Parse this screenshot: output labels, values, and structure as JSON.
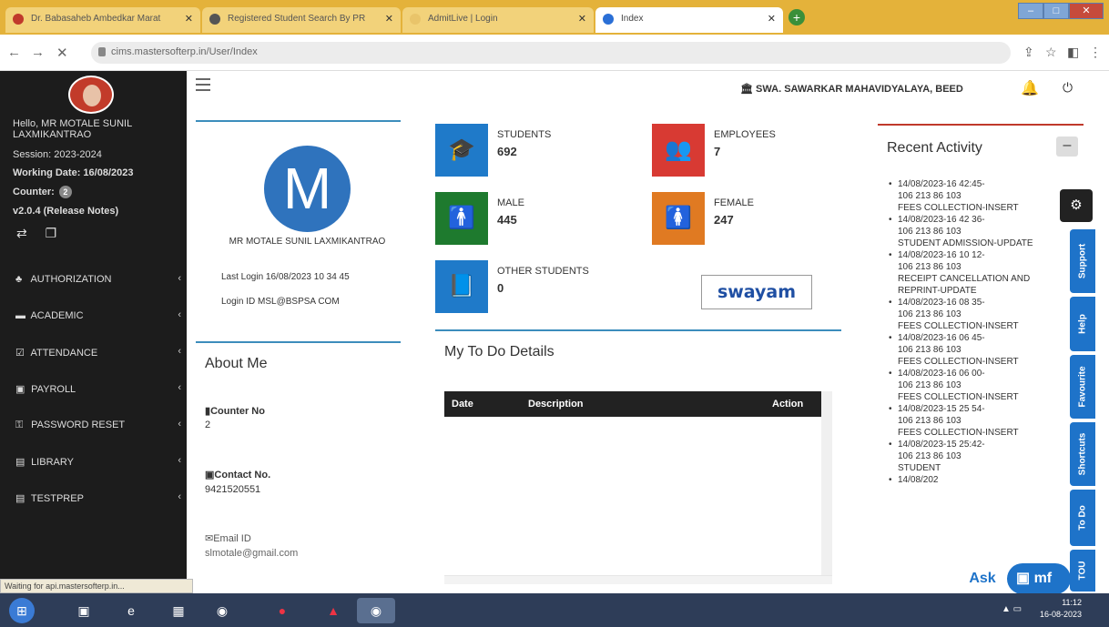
{
  "browser": {
    "tabs": [
      {
        "title": "Dr. Babasaheb Ambedkar Marat",
        "active": false
      },
      {
        "title": "Registered Student Search By PR",
        "active": false
      },
      {
        "title": "AdmitLive | Login",
        "active": false
      },
      {
        "title": "Index",
        "active": true
      }
    ],
    "url": "cims.mastersofterp.in/User/Index"
  },
  "sidebar": {
    "hello": "Hello, MR MOTALE SUNIL LAXMIKANTRAO",
    "session": "Session: 2023-2024",
    "working_date": "Working Date: 16/08/2023",
    "counter_label": "Counter:",
    "counter_value": "2",
    "version": "v2.0.4 (Release Notes)",
    "menu": [
      {
        "label": "AUTHORIZATION",
        "icon": "users-icon"
      },
      {
        "label": "ACADEMIC",
        "icon": "graduation-cap-icon"
      },
      {
        "label": "ATTENDANCE",
        "icon": "checkbox-icon"
      },
      {
        "label": "PAYROLL",
        "icon": "money-icon"
      },
      {
        "label": "PASSWORD RESET",
        "icon": "key-icon"
      },
      {
        "label": "LIBRARY",
        "icon": "book-icon"
      },
      {
        "label": "TESTPREP",
        "icon": "book-icon"
      }
    ]
  },
  "status_bar": "Waiting for api.mastersofterp.in...",
  "header": {
    "college": "SWA. SAWARKAR MAHAVIDYALAYA, BEED"
  },
  "profile": {
    "initial": "M",
    "name": "MR MOTALE SUNIL LAXMIKANTRAO",
    "last_login": "Last Login  16/08/2023 10 34 45",
    "login_id": "Login ID  MSL@BSPSA COM"
  },
  "about": {
    "title": "About Me",
    "counter_label": "Counter No",
    "counter_value": "2",
    "contact_label": "Contact No.",
    "contact_value": "9421520551",
    "email_label": "Email ID",
    "email_value": "slmotale@gmail.com"
  },
  "stats": [
    {
      "label": "STUDENTS",
      "value": "692",
      "color": "#1f7ac9",
      "icon": "graduation-cap-icon"
    },
    {
      "label": "EMPLOYEES",
      "value": "7",
      "color": "#d83a33",
      "icon": "users-icon"
    },
    {
      "label": "MALE",
      "value": "445",
      "color": "#1e7a2e",
      "icon": "male-icon"
    },
    {
      "label": "FEMALE",
      "value": "247",
      "color": "#e07a22",
      "icon": "female-icon"
    },
    {
      "label": "OTHER STUDENTS",
      "value": "0",
      "color": "#1f7ac9",
      "icon": "book-icon"
    }
  ],
  "swayam": "swayam",
  "todo": {
    "title": "My To Do Details",
    "columns": [
      "Date",
      "Description",
      "Action"
    ]
  },
  "recent": {
    "title": "Recent Activity",
    "items": [
      [
        "14/08/2023-16 42:45-",
        "106 213 86 103",
        "FEES COLLECTION-INSERT"
      ],
      [
        "14/08/2023-16 42 36-",
        "106 213 86 103",
        "STUDENT ADMISSION-UPDATE"
      ],
      [
        "14/08/2023-16 10 12-",
        "106 213 86 103",
        "RECEIPT CANCELLATION AND",
        "REPRINT-UPDATE"
      ],
      [
        "14/08/2023-16 08 35-",
        "106 213 86 103",
        "FEES COLLECTION-INSERT"
      ],
      [
        "14/08/2023-16 06 45-",
        "106 213 86 103",
        "FEES COLLECTION-INSERT"
      ],
      [
        "14/08/2023-16 06 00-",
        "106 213 86 103",
        "FEES COLLECTION-INSERT"
      ],
      [
        "14/08/2023-15 25 54-",
        "106 213 86 103",
        "FEES COLLECTION-INSERT"
      ],
      [
        "14/08/2023-15 25:42-",
        "106 213 86 103",
        "STUDENT"
      ],
      [
        "14/08/202"
      ]
    ]
  },
  "side_tabs": [
    "Support",
    "Help",
    "Favourite",
    "Shortcuts",
    "To Do",
    "TOU"
  ],
  "ask_label": "Ask",
  "mf_label": "mf",
  "clock": {
    "time": "11:12",
    "date": "16-08-2023"
  }
}
